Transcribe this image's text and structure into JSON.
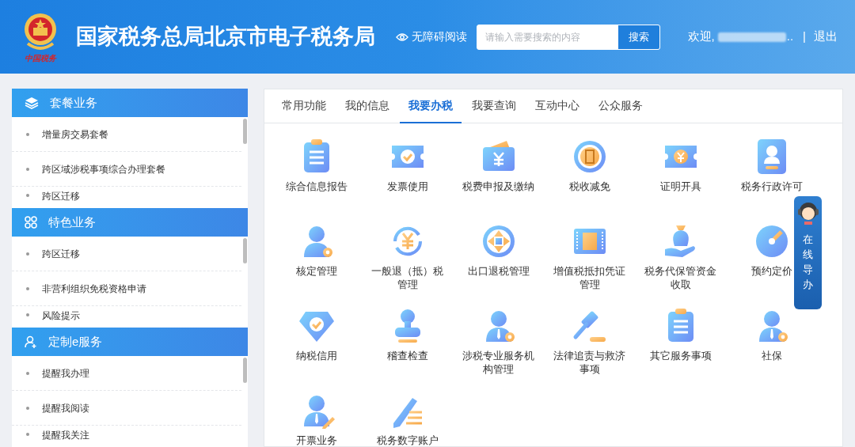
{
  "header": {
    "logo_caption": "中国税务",
    "title": "国家税务总局北京市电子税务局",
    "accessibility_link": "无障碍阅读",
    "search": {
      "placeholder": "请输入需要搜索的内容",
      "button": "搜索"
    },
    "welcome": "欢迎,",
    "name_suffix": "..",
    "separator": "|",
    "logout": "退出"
  },
  "sidebar": [
    {
      "title": "套餐业务",
      "items": [
        "增量房交易套餐",
        "跨区域涉税事项综合办理套餐",
        "跨区迁移"
      ]
    },
    {
      "title": "特色业务",
      "items": [
        "跨区迁移",
        "非营利组织免税资格申请",
        "风险提示"
      ]
    },
    {
      "title": "定制e服务",
      "items": [
        "提醒我办理",
        "提醒我阅读",
        "提醒我关注"
      ]
    }
  ],
  "tabs": [
    {
      "label": "常用功能",
      "selected": false
    },
    {
      "label": "我的信息",
      "selected": false
    },
    {
      "label": "我要办税",
      "selected": true
    },
    {
      "label": "我要查询",
      "selected": false
    },
    {
      "label": "互动中心",
      "selected": false
    },
    {
      "label": "公众服务",
      "selected": false
    }
  ],
  "functions": [
    "综合信息报告",
    "发票使用",
    "税费申报及缴纳",
    "税收减免",
    "证明开具",
    "税务行政许可",
    "核定管理",
    "一般退（抵）税管理",
    "出口退税管理",
    "增值税抵扣凭证管理",
    "税务代保管资金收取",
    "预约定价",
    "纳税信用",
    "稽查检查",
    "涉税专业服务机构管理",
    "法律追责与救济事项",
    "其它服务事项",
    "社保",
    "开票业务",
    "税务数字账户"
  ],
  "online_guide": "在线导办"
}
